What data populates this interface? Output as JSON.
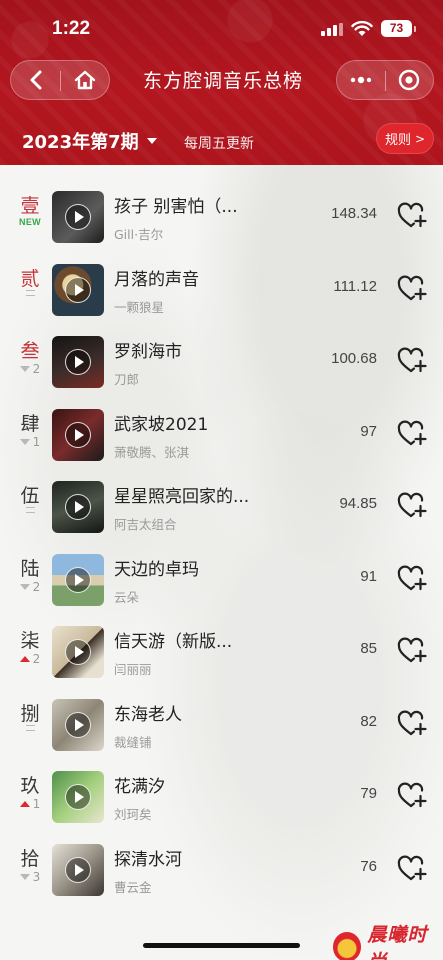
{
  "status_bar": {
    "time": "1:22",
    "battery": "73"
  },
  "nav": {
    "title": "东方腔调音乐总榜"
  },
  "week": {
    "label": "2023年第7期",
    "note": "每周五更新",
    "rules_label": "规则"
  },
  "colors": {
    "brand_red": "#a3131c",
    "rank_red": "#c4323a",
    "up_red": "#e0262d",
    "new_green": "#3aa64b"
  },
  "chart_list": [
    {
      "rank": "壹",
      "trend": "new",
      "trend_label": "NEW",
      "title": "孩子 别害怕（...",
      "artist": "Gill·吉尔",
      "score": "148.34"
    },
    {
      "rank": "贰",
      "trend": "same",
      "trend_label": "",
      "title": "月落的声音",
      "artist": "一颗狼星",
      "score": "111.12"
    },
    {
      "rank": "叁",
      "trend": "down",
      "trend_label": "2",
      "title": "罗刹海市",
      "artist": "刀郎",
      "score": "100.68"
    },
    {
      "rank": "肆",
      "trend": "down",
      "trend_label": "1",
      "title": "武家坡2021",
      "artist": "萧敬腾、张淇",
      "score": "97"
    },
    {
      "rank": "伍",
      "trend": "same",
      "trend_label": "",
      "title": "星星照亮回家的...",
      "artist": "阿吉太组合",
      "score": "94.85"
    },
    {
      "rank": "陆",
      "trend": "down",
      "trend_label": "2",
      "title": "天边的卓玛",
      "artist": "云朵",
      "score": "91"
    },
    {
      "rank": "柒",
      "trend": "up",
      "trend_label": "2",
      "title": "信天游（新版...",
      "artist": "闫丽丽",
      "score": "85"
    },
    {
      "rank": "捌",
      "trend": "same",
      "trend_label": "",
      "title": "东海老人",
      "artist": "裁缝铺",
      "score": "82"
    },
    {
      "rank": "玖",
      "trend": "up",
      "trend_label": "1",
      "title": "花满汐",
      "artist": "刘珂矣",
      "score": "79"
    },
    {
      "rank": "拾",
      "trend": "down",
      "trend_label": "3",
      "title": "探清水河",
      "artist": "曹云金",
      "score": "76"
    }
  ],
  "watermark": {
    "text": "晨曦时尚"
  }
}
